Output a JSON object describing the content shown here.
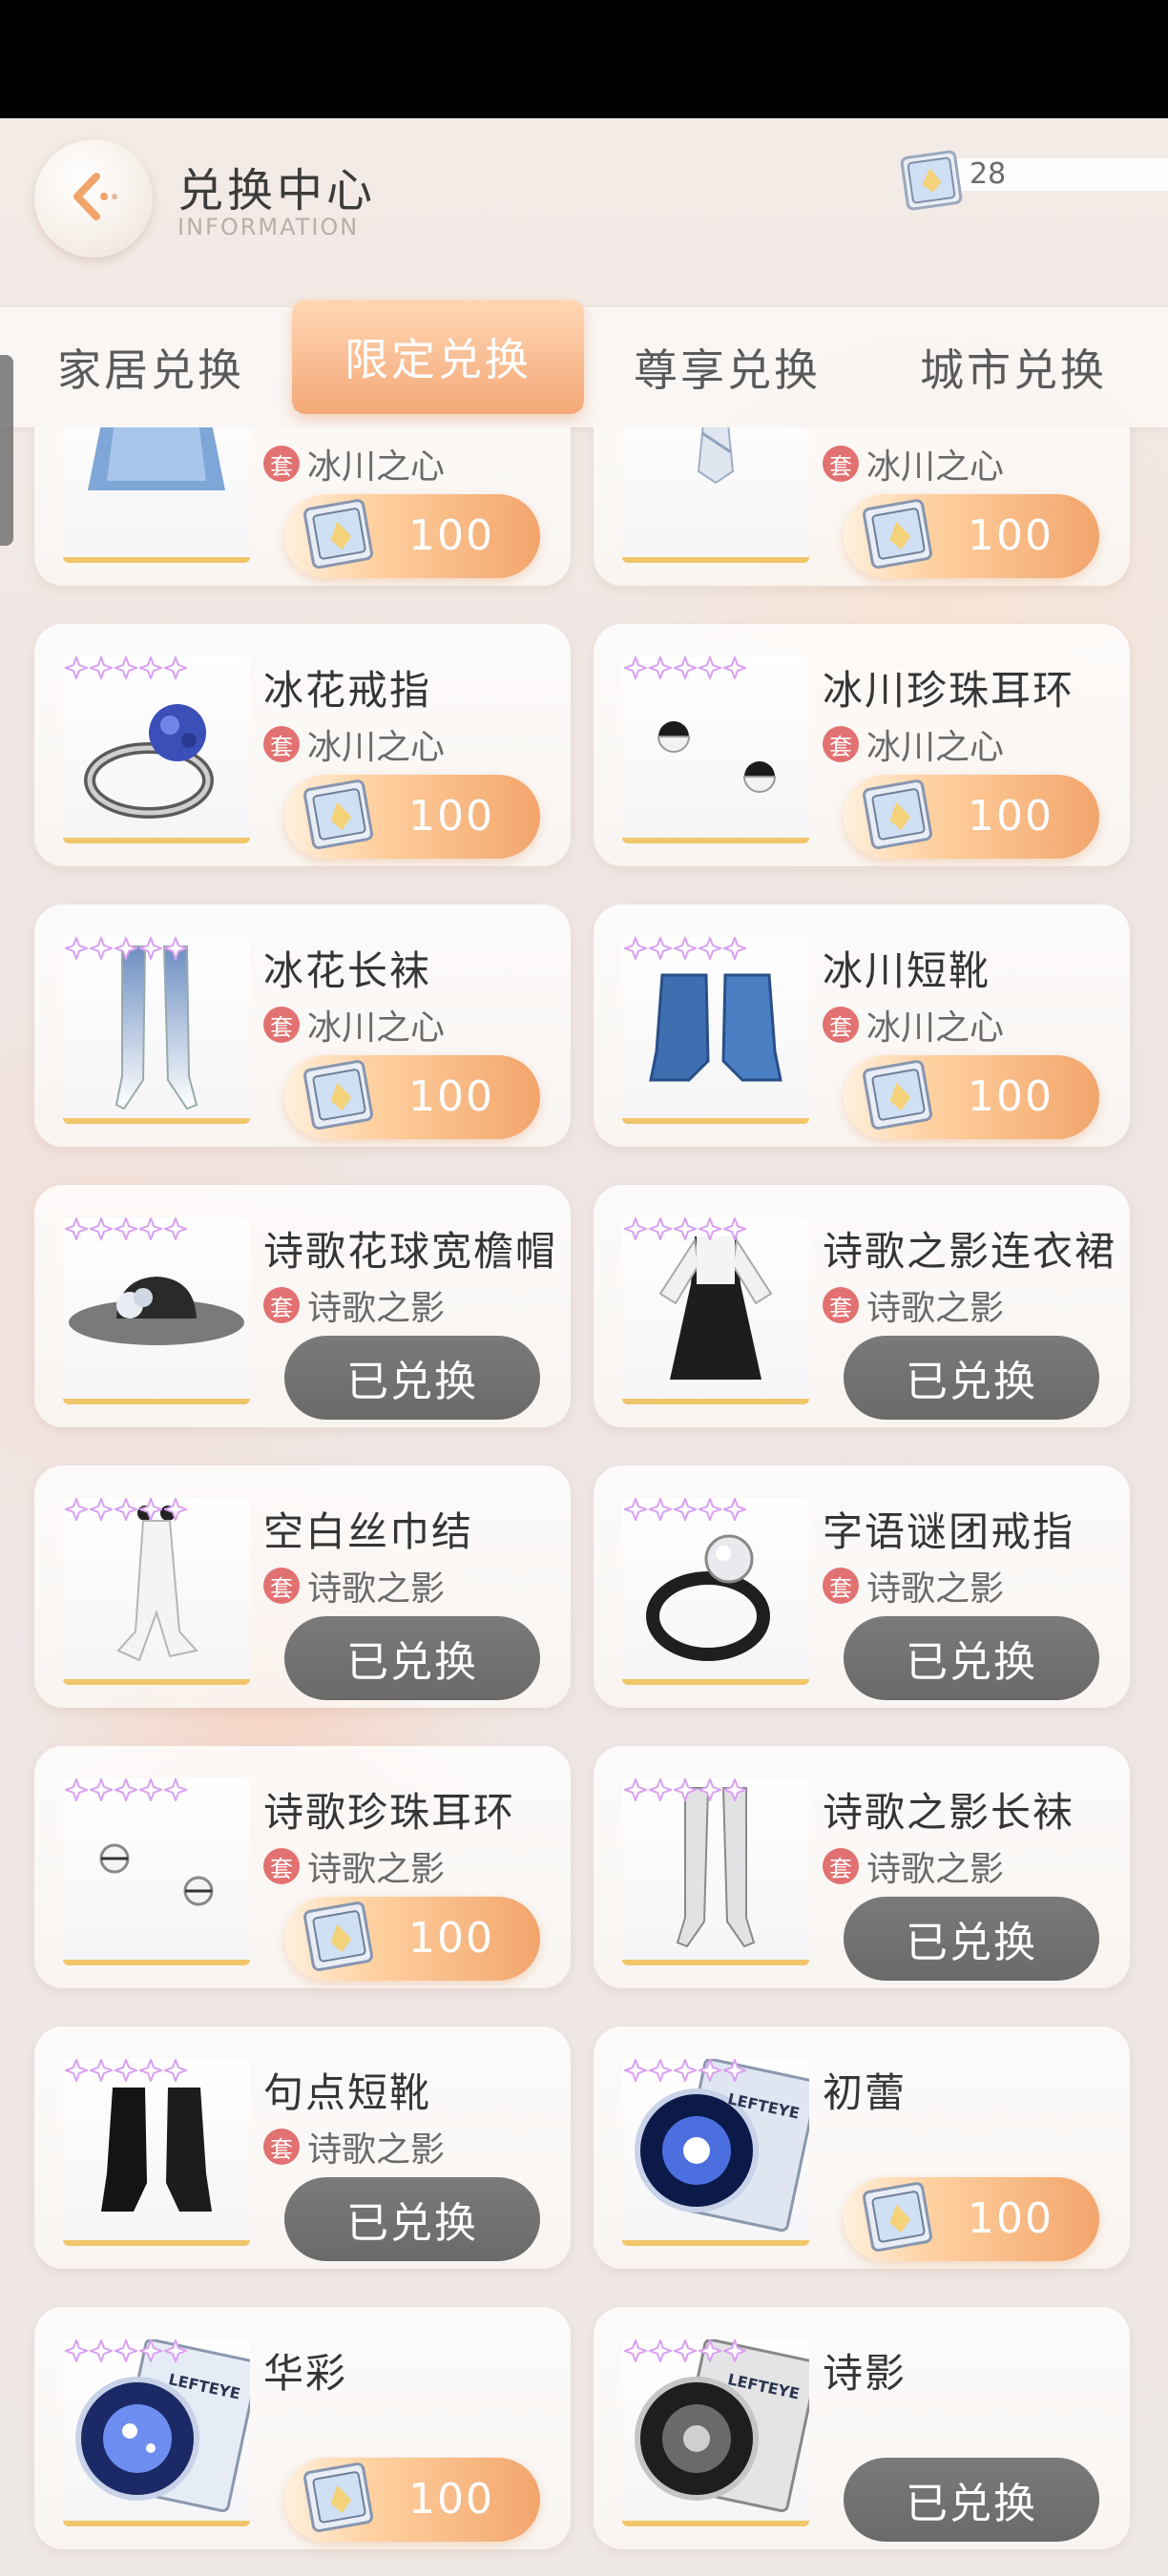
{
  "header": {
    "title": "兑换中心",
    "subtitle": "INFORMATION",
    "currency_value": "28"
  },
  "tabs": [
    "家居兑换",
    "限定兑换",
    "尊享兑换",
    "城市兑换"
  ],
  "active_tab": "限定兑换",
  "set_badge": "套",
  "items": [
    {
      "name": "",
      "set": "冰川之心",
      "status": "price",
      "price": "100",
      "thumb": "blue-dress"
    },
    {
      "name": "",
      "set": "冰川之心",
      "status": "price",
      "price": "100",
      "thumb": "tie"
    },
    {
      "name": "冰花戒指",
      "set": "冰川之心",
      "status": "price",
      "price": "100",
      "thumb": "ring-blue"
    },
    {
      "name": "冰川珍珠耳环",
      "set": "冰川之心",
      "status": "price",
      "price": "100",
      "thumb": "earrings"
    },
    {
      "name": "冰花长袜",
      "set": "冰川之心",
      "status": "price",
      "price": "100",
      "thumb": "stockings-blue"
    },
    {
      "name": "冰川短靴",
      "set": "冰川之心",
      "status": "price",
      "price": "100",
      "thumb": "boots-blue"
    },
    {
      "name": "诗歌花球宽檐帽",
      "set": "诗歌之影",
      "status": "redeemed",
      "label": "已兑换",
      "thumb": "hat"
    },
    {
      "name": "诗歌之影连衣裙",
      "set": "诗歌之影",
      "status": "redeemed",
      "label": "已兑换",
      "thumb": "black-dress"
    },
    {
      "name": "空白丝巾结",
      "set": "诗歌之影",
      "status": "redeemed",
      "label": "已兑换",
      "thumb": "scarf"
    },
    {
      "name": "字语谜团戒指",
      "set": "诗歌之影",
      "status": "redeemed",
      "label": "已兑换",
      "thumb": "ring-black"
    },
    {
      "name": "诗歌珍珠耳环",
      "set": "诗歌之影",
      "status": "price",
      "price": "100",
      "thumb": "earrings-silver"
    },
    {
      "name": "诗歌之影长袜",
      "set": "诗歌之影",
      "status": "redeemed",
      "label": "已兑换",
      "thumb": "stockings-grey"
    },
    {
      "name": "句点短靴",
      "set": "诗歌之影",
      "status": "redeemed",
      "label": "已兑换",
      "thumb": "boots-black"
    },
    {
      "name": "初蕾",
      "set": "",
      "status": "price",
      "price": "100",
      "thumb": "lens-blue"
    },
    {
      "name": "华彩",
      "set": "",
      "status": "price",
      "price": "100",
      "thumb": "lens-sparkle"
    },
    {
      "name": "诗影",
      "set": "",
      "status": "redeemed",
      "label": "已兑换",
      "thumb": "lens-grey"
    }
  ],
  "lens_label": "LEFTEYE",
  "colors": {
    "accent_orange": "#f2a56c",
    "redeemed_grey": "#6e6e6e",
    "set_badge_red": "#e27171",
    "rarity_gold": "#f1c66a"
  }
}
